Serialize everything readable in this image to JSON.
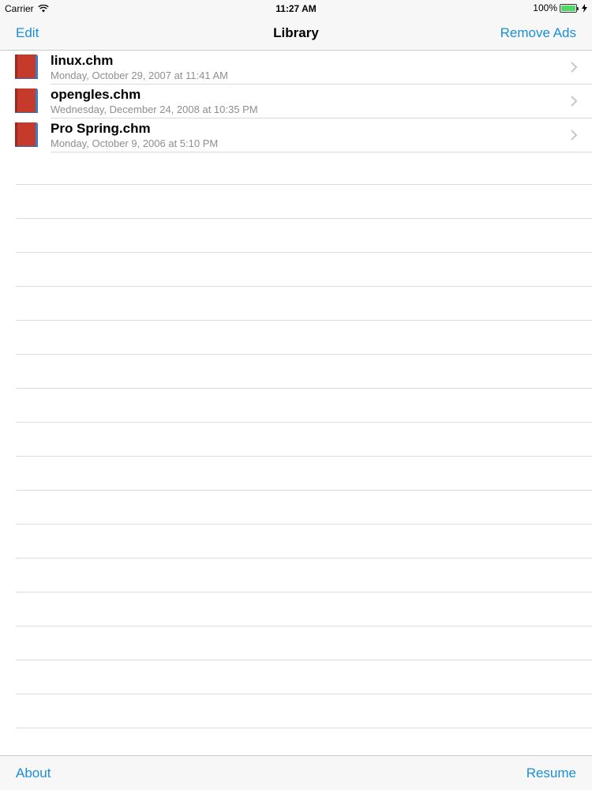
{
  "status_bar": {
    "carrier": "Carrier",
    "time": "11:27 AM",
    "battery": "100%",
    "icons": [
      "wifi-icon",
      "battery-icon",
      "charging-bolt-icon"
    ]
  },
  "nav": {
    "edit_label": "Edit",
    "title": "Library",
    "remove_ads_label": "Remove Ads"
  },
  "files": [
    {
      "name": "linux.chm",
      "date": "Monday, October 29, 2007 at 11:41 AM"
    },
    {
      "name": "opengles.chm",
      "date": "Wednesday, December 24, 2008 at 10:35 PM"
    },
    {
      "name": "Pro Spring.chm",
      "date": "Monday, October 9, 2006 at 5:10 PM"
    }
  ],
  "toolbar": {
    "about_label": "About",
    "resume_label": "Resume"
  },
  "colors": {
    "accent": "#1a8fd6",
    "book_red": "#c0392b",
    "secondary_text": "#8e8e93"
  }
}
